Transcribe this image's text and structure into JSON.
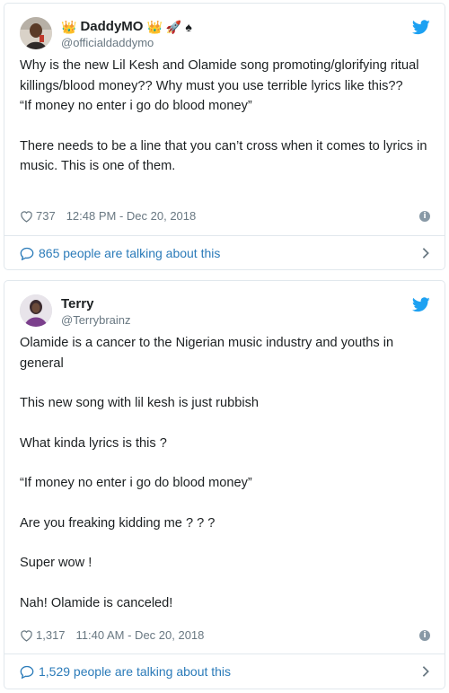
{
  "tweets": [
    {
      "user": {
        "display_name": "DaddyMO",
        "handle": "@officialdaddymo",
        "emojis": [
          "👑",
          "👑",
          "🚀",
          "♠"
        ]
      },
      "paragraphs": [
        "Why is the new Lil Kesh and Olamide song promoting/glorifying ritual killings/blood money?? Why must you use terrible lyrics like this??\n“If money no enter i go do blood money”",
        "There needs to be a line that you can’t cross when it comes to lyrics in music. This is one of them."
      ],
      "likes": "737",
      "timestamp": "12:48 PM - Dec 20, 2018",
      "talking": "865 people are talking about this"
    },
    {
      "user": {
        "display_name": "Terry",
        "handle": "@Terrybrainz",
        "emojis": []
      },
      "paragraphs": [
        "Olamide is a cancer to the Nigerian music industry and youths in general",
        "This new song with lil kesh is just rubbish",
        "What kinda lyrics is this ?",
        "“If money no enter i go do blood money”",
        "Are you freaking kidding me ? ? ?",
        "Super wow !",
        "Nah! Olamide is canceled!"
      ],
      "likes": "1,317",
      "timestamp": "11:40 AM - Dec 20, 2018",
      "talking": "1,529 people are talking about this"
    }
  ],
  "colors": {
    "link": "#2b7bb9",
    "twitter_blue": "#1da1f2",
    "muted": "#697882",
    "border": "#e1e8ed"
  },
  "icons": {
    "brand": "twitter-bird-icon",
    "like": "heart-icon",
    "info": "info-icon",
    "reply": "speech-bubble-icon",
    "expand": "chevron-right-icon"
  }
}
